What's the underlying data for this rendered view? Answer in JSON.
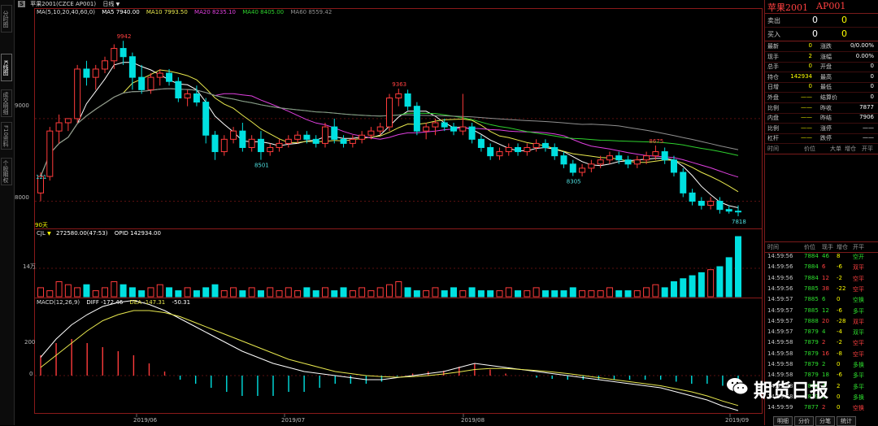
{
  "sidebar": {
    "tabs": [
      "分时图",
      "K线图",
      "成交明细",
      "F10资料",
      "个股期权"
    ]
  },
  "topbar": {
    "logo": "S",
    "contract": "苹果2001(CZCE AP001)",
    "period": "日线"
  },
  "price_pane": {
    "ma_params": "MA(5,10,20,40,60,0)",
    "ma_values": [
      {
        "label": "MA5 7940.00",
        "color": "#ffffff"
      },
      {
        "label": "MA10 7993.50",
        "color": "#e8e84e"
      },
      {
        "label": "MA20 8235.10",
        "color": "#e040e0"
      },
      {
        "label": "MA40 8405.00",
        "color": "#2ed12e"
      },
      {
        "label": "MA60 8559.42",
        "color": "#909090"
      }
    ],
    "y_ticks": [
      "9000",
      "8000"
    ],
    "annotations": {
      "high1": "9942",
      "high2": "9363",
      "low1": "8501",
      "low2": "8305",
      "high3": "8675",
      "last": "7818",
      "left": "121"
    },
    "period_label": "90天"
  },
  "volume_pane": {
    "title": "CJL",
    "vol": "272580.00(47:53)",
    "oi": "OPID 142934.00",
    "y_tick": "14万"
  },
  "macd_pane": {
    "title": "MACD(12,26,9)",
    "diff": "DIFF -172.46",
    "dea": "DEA -147.31",
    "macd": "-50.31",
    "y_tick": "200",
    "zero_tick": "0"
  },
  "x_axis": [
    "2019/06",
    "2019/07",
    "2019/08",
    "2019/09"
  ],
  "colors": {
    "up": "#ff3b3b",
    "down": "#00e0e0",
    "frame": "#8a1a1a"
  },
  "quote_header": {
    "name": "苹果2001",
    "code": "AP001"
  },
  "order_book": [
    {
      "label": "卖出",
      "price": "0",
      "vol": "0"
    },
    {
      "label": "买入",
      "price": "0",
      "vol": "0"
    }
  ],
  "stats": [
    {
      "l1": "最新",
      "v1": "0",
      "l2": "涨跌",
      "v2": "0/0.00%"
    },
    {
      "l1": "现手",
      "v1": "2",
      "l2": "涨幅",
      "v2": "0.00%"
    },
    {
      "l1": "总手",
      "v1": "0",
      "l2": "开盘",
      "v2": "0"
    },
    {
      "l1": "持仓",
      "v1": "142934",
      "l2": "最高",
      "v2": "0"
    },
    {
      "l1": "日增",
      "v1": "0",
      "l2": "最低",
      "v2": "0"
    },
    {
      "l1": "外盘",
      "v1": "——",
      "l2": "结算价",
      "v2": "0"
    },
    {
      "l1": "比例",
      "v1": "——",
      "l2": "昨收",
      "v2": "7877"
    },
    {
      "l1": "内盘",
      "v1": "——",
      "l2": "昨结",
      "v2": "7906"
    },
    {
      "l1": "比例",
      "v1": "——",
      "l2": "涨停",
      "v2": "——"
    },
    {
      "l1": "杠杆",
      "v1": "——",
      "l2": "跌停",
      "v2": "——"
    }
  ],
  "ticks_header": [
    "时间",
    "价位",
    "大单",
    "增仓",
    "开平"
  ],
  "trades_header": [
    "时间",
    "价位",
    "现手",
    "增仓",
    "开平"
  ],
  "trades": [
    {
      "t": "14:59:56",
      "p": "7884",
      "v": "46",
      "oi": "8",
      "type": "空开",
      "oic": "#ffff00",
      "vc": "#2ee02e"
    },
    {
      "t": "14:59:56",
      "p": "7884",
      "v": "6",
      "oi": "-6",
      "type": "双平",
      "oic": "#ffff00",
      "vc": "#ff4040"
    },
    {
      "t": "14:59:56",
      "p": "7884",
      "v": "12",
      "oi": "-2",
      "type": "空平",
      "oic": "#ffff00",
      "vc": "#ff4040"
    },
    {
      "t": "14:59:56",
      "p": "7885",
      "v": "38",
      "oi": "-22",
      "type": "空平",
      "oic": "#ffff00",
      "vc": "#ff4040"
    },
    {
      "t": "14:59:57",
      "p": "7885",
      "v": "6",
      "oi": "0",
      "type": "空换",
      "oic": "#ffff00",
      "vc": "#2ee02e"
    },
    {
      "t": "14:59:57",
      "p": "7885",
      "v": "12",
      "oi": "-6",
      "type": "多平",
      "oic": "#ffff00",
      "vc": "#2ee02e"
    },
    {
      "t": "14:59:57",
      "p": "7888",
      "v": "20",
      "oi": "-28",
      "type": "双平",
      "oic": "#ffff00",
      "vc": "#ff4040"
    },
    {
      "t": "14:59:57",
      "p": "7879",
      "v": "4",
      "oi": "-4",
      "type": "双平",
      "oic": "#ffff00",
      "vc": "#2ee02e"
    },
    {
      "t": "14:59:58",
      "p": "7879",
      "v": "2",
      "oi": "-2",
      "type": "空平",
      "oic": "#ffff00",
      "vc": "#ff4040"
    },
    {
      "t": "14:59:58",
      "p": "7879",
      "v": "16",
      "oi": "-8",
      "type": "空平",
      "oic": "#ffff00",
      "vc": "#ff4040"
    },
    {
      "t": "14:59:58",
      "p": "7879",
      "v": "2",
      "oi": "0",
      "type": "多换",
      "oic": "#ffff00",
      "vc": "#2ee02e"
    },
    {
      "t": "14:59:58",
      "p": "7879",
      "v": "18",
      "oi": "-6",
      "type": "多平",
      "oic": "#ffff00",
      "vc": "#2ee02e"
    },
    {
      "t": "14:59:58",
      "p": "7879",
      "v": "4",
      "oi": "2",
      "type": "多平",
      "oic": "#ffff00",
      "vc": "#2ee02e"
    },
    {
      "t": "14:59:58",
      "p": "7879",
      "v": "6",
      "oi": "0",
      "type": "多换",
      "oic": "#ffff00",
      "vc": "#2ee02e"
    },
    {
      "t": "14:59:59",
      "p": "7877",
      "v": "2",
      "oi": "0",
      "type": "空换",
      "oic": "#ffff00",
      "vc": "#ff4040"
    }
  ],
  "bottom_tabs": [
    "明细",
    "分价",
    "分笔",
    "统计"
  ],
  "watermark": {
    "text": "期货日报"
  },
  "chart_data": {
    "type": "candlestick",
    "x_labels": [
      "2019/06",
      "2019/07",
      "2019/08",
      "2019/09"
    ],
    "ylim": [
      7700,
      10200
    ],
    "y_ticks": [
      9000,
      8000
    ],
    "ohlc": [
      [
        8100,
        8350,
        8000,
        8300
      ],
      [
        8300,
        8900,
        8250,
        8850
      ],
      [
        8850,
        9050,
        8700,
        8950
      ],
      [
        8950,
        9000,
        8850,
        9000
      ],
      [
        9000,
        9650,
        8950,
        9600
      ],
      [
        9600,
        9700,
        9400,
        9500
      ],
      [
        9500,
        9650,
        9350,
        9600
      ],
      [
        9600,
        9750,
        9550,
        9700
      ],
      [
        9700,
        9900,
        9600,
        9850
      ],
      [
        9850,
        9942,
        9650,
        9750
      ],
      [
        9750,
        9800,
        9350,
        9500
      ],
      [
        9500,
        9650,
        9300,
        9350
      ],
      [
        9350,
        9550,
        9300,
        9500
      ],
      [
        9500,
        9600,
        9400,
        9550
      ],
      [
        9550,
        9600,
        9400,
        9450
      ],
      [
        9450,
        9500,
        9200,
        9250
      ],
      [
        9250,
        9350,
        9150,
        9300
      ],
      [
        9300,
        9400,
        9150,
        9200
      ],
      [
        9200,
        9250,
        8700,
        8800
      ],
      [
        8800,
        8850,
        8500,
        8600
      ],
      [
        8600,
        8800,
        8550,
        8750
      ],
      [
        8750,
        8900,
        8700,
        8850
      ],
      [
        8850,
        8950,
        8600,
        8650
      ],
      [
        8650,
        8800,
        8600,
        8750
      ],
      [
        8750,
        8850,
        8501,
        8600
      ],
      [
        8600,
        8700,
        8550,
        8650
      ],
      [
        8650,
        8750,
        8600,
        8700
      ],
      [
        8700,
        8800,
        8650,
        8750
      ],
      [
        8750,
        8850,
        8700,
        8800
      ],
      [
        8800,
        8850,
        8700,
        8750
      ],
      [
        8750,
        8800,
        8650,
        8700
      ],
      [
        8700,
        8950,
        8650,
        8900
      ],
      [
        8900,
        9000,
        8700,
        8750
      ],
      [
        8750,
        8800,
        8650,
        8700
      ],
      [
        8700,
        8800,
        8650,
        8750
      ],
      [
        8750,
        8850,
        8700,
        8800
      ],
      [
        8800,
        8900,
        8750,
        8850
      ],
      [
        8850,
        8950,
        8800,
        8900
      ],
      [
        8900,
        9300,
        8850,
        9250
      ],
      [
        9250,
        9363,
        9150,
        9300
      ],
      [
        9300,
        9350,
        9100,
        9150
      ],
      [
        9150,
        9200,
        8800,
        8850
      ],
      [
        8850,
        8950,
        8750,
        8900
      ],
      [
        8900,
        9000,
        8800,
        8950
      ],
      [
        8950,
        9000,
        8850,
        8900
      ],
      [
        8900,
        8950,
        8800,
        8850
      ],
      [
        8850,
        9300,
        8800,
        8900
      ],
      [
        8900,
        8950,
        8700,
        8750
      ],
      [
        8750,
        8800,
        8600,
        8650
      ],
      [
        8650,
        8700,
        8500,
        8550
      ],
      [
        8550,
        8650,
        8500,
        8600
      ],
      [
        8600,
        8700,
        8550,
        8650
      ],
      [
        8650,
        8700,
        8550,
        8600
      ],
      [
        8600,
        8700,
        8550,
        8650
      ],
      [
        8650,
        8750,
        8600,
        8700
      ],
      [
        8700,
        8750,
        8600,
        8650
      ],
      [
        8650,
        8700,
        8500,
        8550
      ],
      [
        8550,
        8600,
        8400,
        8450
      ],
      [
        8450,
        8500,
        8305,
        8350
      ],
      [
        8350,
        8450,
        8300,
        8400
      ],
      [
        8400,
        8500,
        8350,
        8450
      ],
      [
        8450,
        8550,
        8400,
        8500
      ],
      [
        8500,
        8600,
        8450,
        8550
      ],
      [
        8550,
        8600,
        8450,
        8500
      ],
      [
        8500,
        8550,
        8400,
        8450
      ],
      [
        8450,
        8550,
        8400,
        8500
      ],
      [
        8500,
        8600,
        8450,
        8550
      ],
      [
        8550,
        8675,
        8500,
        8600
      ],
      [
        8600,
        8650,
        8450,
        8500
      ],
      [
        8500,
        8550,
        8300,
        8350
      ],
      [
        8350,
        8400,
        8050,
        8100
      ],
      [
        8100,
        8150,
        7950,
        8000
      ],
      [
        8000,
        8050,
        7900,
        7950
      ],
      [
        7950,
        8050,
        7900,
        8000
      ],
      [
        8000,
        8050,
        7850,
        7900
      ],
      [
        7900,
        7950,
        7850,
        7880
      ],
      [
        7880,
        7950,
        7818,
        7877
      ]
    ],
    "volume": [
      3,
      2,
      5,
      4,
      3,
      4,
      2,
      3,
      5,
      4,
      3,
      2,
      3,
      4,
      3,
      2,
      3,
      2,
      3,
      4,
      2,
      3,
      2,
      3,
      2,
      3,
      2,
      3,
      2,
      3,
      2,
      3,
      2,
      3,
      2,
      3,
      2,
      3,
      4,
      5,
      3,
      2,
      2,
      3,
      2,
      3,
      2,
      3,
      2,
      2,
      2,
      3,
      2,
      2,
      3,
      2,
      2,
      2,
      3,
      2,
      2,
      2,
      3,
      2,
      2,
      2,
      3,
      4,
      3,
      5,
      6,
      7,
      8,
      9,
      10,
      13,
      20
    ],
    "macd_dif": [
      90,
      180,
      250,
      300,
      340,
      360,
      370,
      350,
      320,
      280,
      240,
      200,
      160,
      120,
      90,
      60,
      40,
      20,
      10,
      0,
      -10,
      -20,
      -20,
      -10,
      0,
      10,
      20,
      40,
      60,
      50,
      40,
      30,
      20,
      10,
      0,
      -10,
      -20,
      -30,
      -40,
      -50,
      -60,
      -80,
      -100,
      -120,
      -150,
      -172
    ],
    "macd_dea": [
      40,
      100,
      160,
      220,
      270,
      300,
      320,
      320,
      310,
      290,
      260,
      230,
      200,
      170,
      140,
      110,
      80,
      60,
      40,
      20,
      10,
      0,
      -5,
      -8,
      -5,
      0,
      8,
      18,
      30,
      35,
      35,
      30,
      25,
      18,
      10,
      0,
      -10,
      -20,
      -30,
      -40,
      -50,
      -65,
      -80,
      -100,
      -125,
      -147
    ]
  }
}
